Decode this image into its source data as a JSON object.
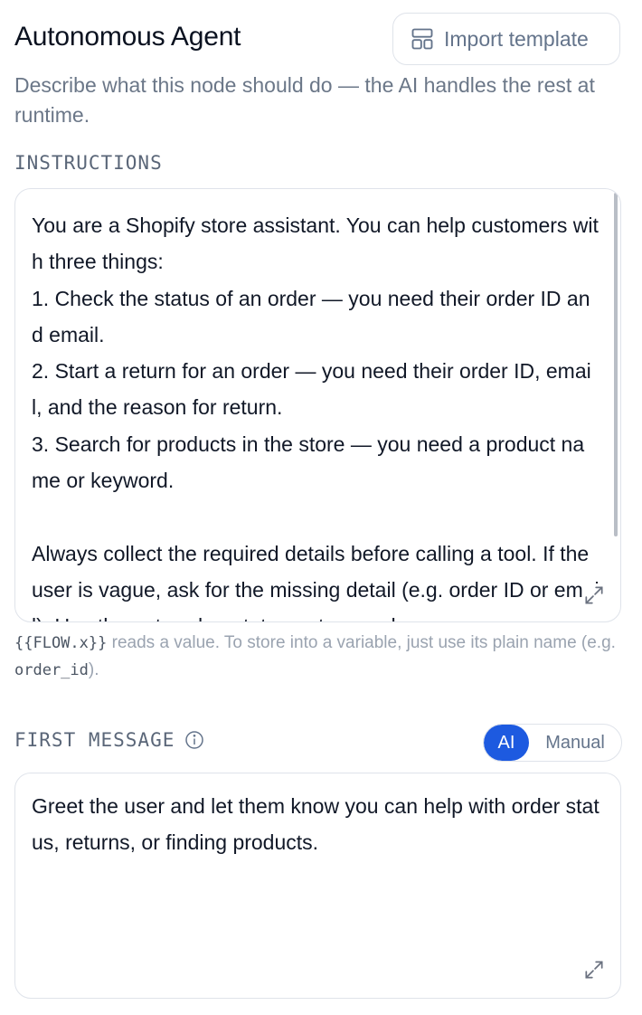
{
  "header": {
    "title": "Autonomous Agent",
    "import_label": "Import template",
    "subtitle": "Describe what this node should do — the AI handles the rest at runtime."
  },
  "instructions": {
    "label": "INSTRUCTIONS",
    "text": "You are a Shopify store assistant. You can help customers with three things:\n1. Check the status of an order — you need their order ID and email.\n2. Start a return for an order — you need their order ID, email, and the reason for return.\n3. Search for products in the store — you need a product name or keyword.\n\nAlways collect the required details before calling a tool. If the user is vague, ask for the missing detail (e.g. order ID or email). Use the get_order_status, return_order",
    "hint_prefix": "{{FLOW.x}}",
    "hint_middle": " reads a value. To store into a variable, just use its plain name (e.g. ",
    "hint_code": "order_id",
    "hint_suffix": ")."
  },
  "first_message": {
    "label": "FIRST MESSAGE",
    "mode_options": [
      "AI",
      "Manual"
    ],
    "selected_mode": "AI",
    "text": "Greet the user and let them know you can help with order status, returns, or finding products."
  },
  "icons": {
    "import": "template-icon",
    "info": "info-icon",
    "expand": "expand-icon"
  },
  "colors": {
    "accent": "#1d5ae0"
  }
}
